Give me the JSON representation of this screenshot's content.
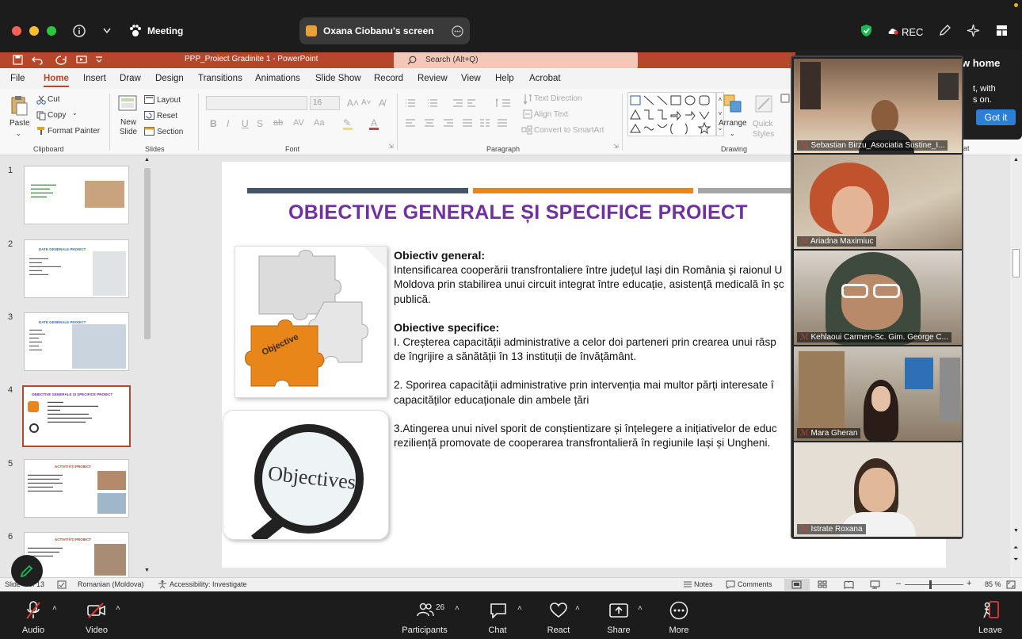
{
  "meeting": {
    "title": "Meeting",
    "screen_owner": "Oxana Ciobanu's screen",
    "rec_label": "REC"
  },
  "ppt": {
    "file_title": "PPP_Proiect Gradinite 1  -  PowerPoint",
    "search_placeholder": "Search (Alt+Q)",
    "tabs": [
      "File",
      "Home",
      "Insert",
      "Draw",
      "Design",
      "Transitions",
      "Animations",
      "Slide Show",
      "Record",
      "Review",
      "View",
      "Help",
      "Acrobat"
    ],
    "ribbon": {
      "paste": "Paste",
      "cut": "Cut",
      "copy": "Copy",
      "format_painter": "Format Painter",
      "clipboard": "Clipboard",
      "new_slide": "New Slide",
      "layout": "Layout",
      "reset": "Reset",
      "section": "Section",
      "slides": "Slides",
      "font_size": "16",
      "font": "Font",
      "text_direction": "Text Direction",
      "align_text": "Align Text",
      "convert_smartart": "Convert to SmartArt",
      "paragraph": "Paragraph",
      "arrange": "Arrange",
      "quick_styles": "Quick Styles",
      "drawing": "Drawing",
      "new_home_title": "w home",
      "new_home_text1": "t, with",
      "new_home_text2": "s on.",
      "got_it": "Got it"
    },
    "thumb_numbers": [
      "1",
      "2",
      "3",
      "4",
      "5",
      "6"
    ],
    "thumb_titles": [
      "",
      "DATE GENERALE PROIECT",
      "DATE GENERALE PROIECT",
      "OBIECTIVE GENERALE ȘI SPECIFICE PROIECT",
      "ACTIVITĂȚI PROIECT",
      "ACTIVITĂȚI PROIECT"
    ],
    "slide": {
      "title": "OBIECTIVE GENERALE ȘI SPECIFICE PROIECT",
      "img1_label": "Objective",
      "img2_label": "Objectives",
      "general_heading": "Obiectiv general:",
      "general_line1": "Intensificarea cooperării transfrontaliere între județul Iași din România și raionul U",
      "general_line2": "Moldova prin stabilirea unui circuit integrat între educație, asistență medicală în șc",
      "general_line3": "publică.",
      "specific_heading": "Obiective specifice:",
      "s1_line1": "I. Creșterea capacității administrative a celor doi parteneri prin crearea unui răsp",
      "s1_line2": "de îngrijire a sănătății în 13 instituții de învățământ.",
      "s2_line1": "2. Sporirea capacității administrative prin intervenția mai multor părți interesate î",
      "s2_line2": "capacităților educaționale din ambele țări",
      "s3_line1": "3.Atingerea unui nivel sporit de conștientizare și înțelegere a inițiativelor de educ",
      "s3_line2": "reziliență promovate de cooperarea transfrontalieră în regiunile Iași și Ungheni."
    },
    "status": {
      "slide_of": "Slide 4 of 13",
      "language": "Romanian (Moldova)",
      "accessibility": "Accessibility: Investigate",
      "notes": "Notes",
      "comments": "Comments",
      "zoom": "85 %"
    }
  },
  "participants": [
    {
      "name": "Sebastian Birzu_Asociatia Sustine_I...",
      "bg": "#b79a7e"
    },
    {
      "name": "Ariadna Maximiuc",
      "bg": "#c9b9a0"
    },
    {
      "name": "Kehlaoui Carmen-Sc. Gim. George C...",
      "bg": "#6c5a48"
    },
    {
      "name": "Mara Gheran",
      "bg": "#8c7a64"
    },
    {
      "name": "Istrate Roxana",
      "bg": "#d8d2c8"
    }
  ],
  "toolbar": {
    "audio": "Audio",
    "video": "Video",
    "participants": "Participants",
    "participant_count": "26",
    "chat": "Chat",
    "react": "React",
    "share": "Share",
    "more": "More",
    "leave": "Leave"
  },
  "colors": {
    "ppt_accent": "#b7472a",
    "slide_title": "#7030a0",
    "puzzle_orange": "#e8861a",
    "zoom_bar": "#1c1c1c"
  }
}
